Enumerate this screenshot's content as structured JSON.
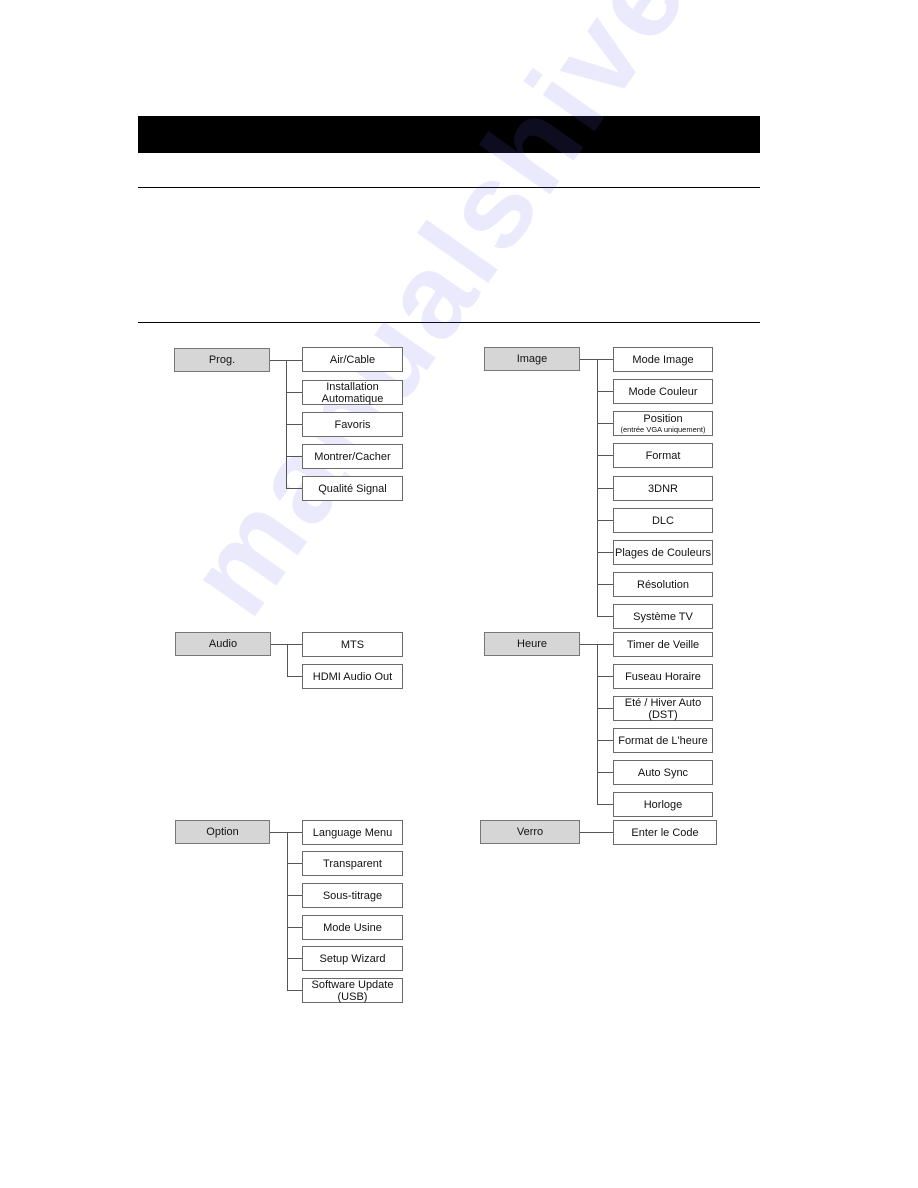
{
  "page": {
    "header_bar_text": "",
    "watermark": "manualshive.com"
  },
  "menu_tree": [
    {
      "root": "Prog.",
      "children": [
        {
          "label": "Air/Cable"
        },
        {
          "label": "Installation Automatique"
        },
        {
          "label": "Favoris"
        },
        {
          "label": "Montrer/Cacher"
        },
        {
          "label": "Qualité Signal"
        }
      ]
    },
    {
      "root": "Image",
      "children": [
        {
          "label": "Mode Image"
        },
        {
          "label": "Mode Couleur"
        },
        {
          "label": "Position",
          "note": "(entrée VGA uniquement)"
        },
        {
          "label": "Format"
        },
        {
          "label": "3DNR"
        },
        {
          "label": "DLC"
        },
        {
          "label": "Plages de Couleurs"
        },
        {
          "label": "Résolution"
        },
        {
          "label": "Système TV"
        }
      ]
    },
    {
      "root": "Audio",
      "children": [
        {
          "label": "MTS"
        },
        {
          "label": "HDMI Audio Out"
        }
      ]
    },
    {
      "root": "Heure",
      "children": [
        {
          "label": "Timer de Veille"
        },
        {
          "label": "Fuseau Horaire"
        },
        {
          "label": "Eté / Hiver Auto (DST)"
        },
        {
          "label": "Format de L'heure"
        },
        {
          "label": "Auto Sync"
        },
        {
          "label": "Horloge"
        }
      ]
    },
    {
      "root": "Option",
      "children": [
        {
          "label": "Language Menu"
        },
        {
          "label": "Transparent"
        },
        {
          "label": "Sous-titrage"
        },
        {
          "label": "Mode Usine"
        },
        {
          "label": "Setup Wizard"
        },
        {
          "label": "Software Update (USB)"
        }
      ]
    },
    {
      "root": "Verro",
      "children": [
        {
          "label": "Enter le Code"
        }
      ]
    }
  ]
}
